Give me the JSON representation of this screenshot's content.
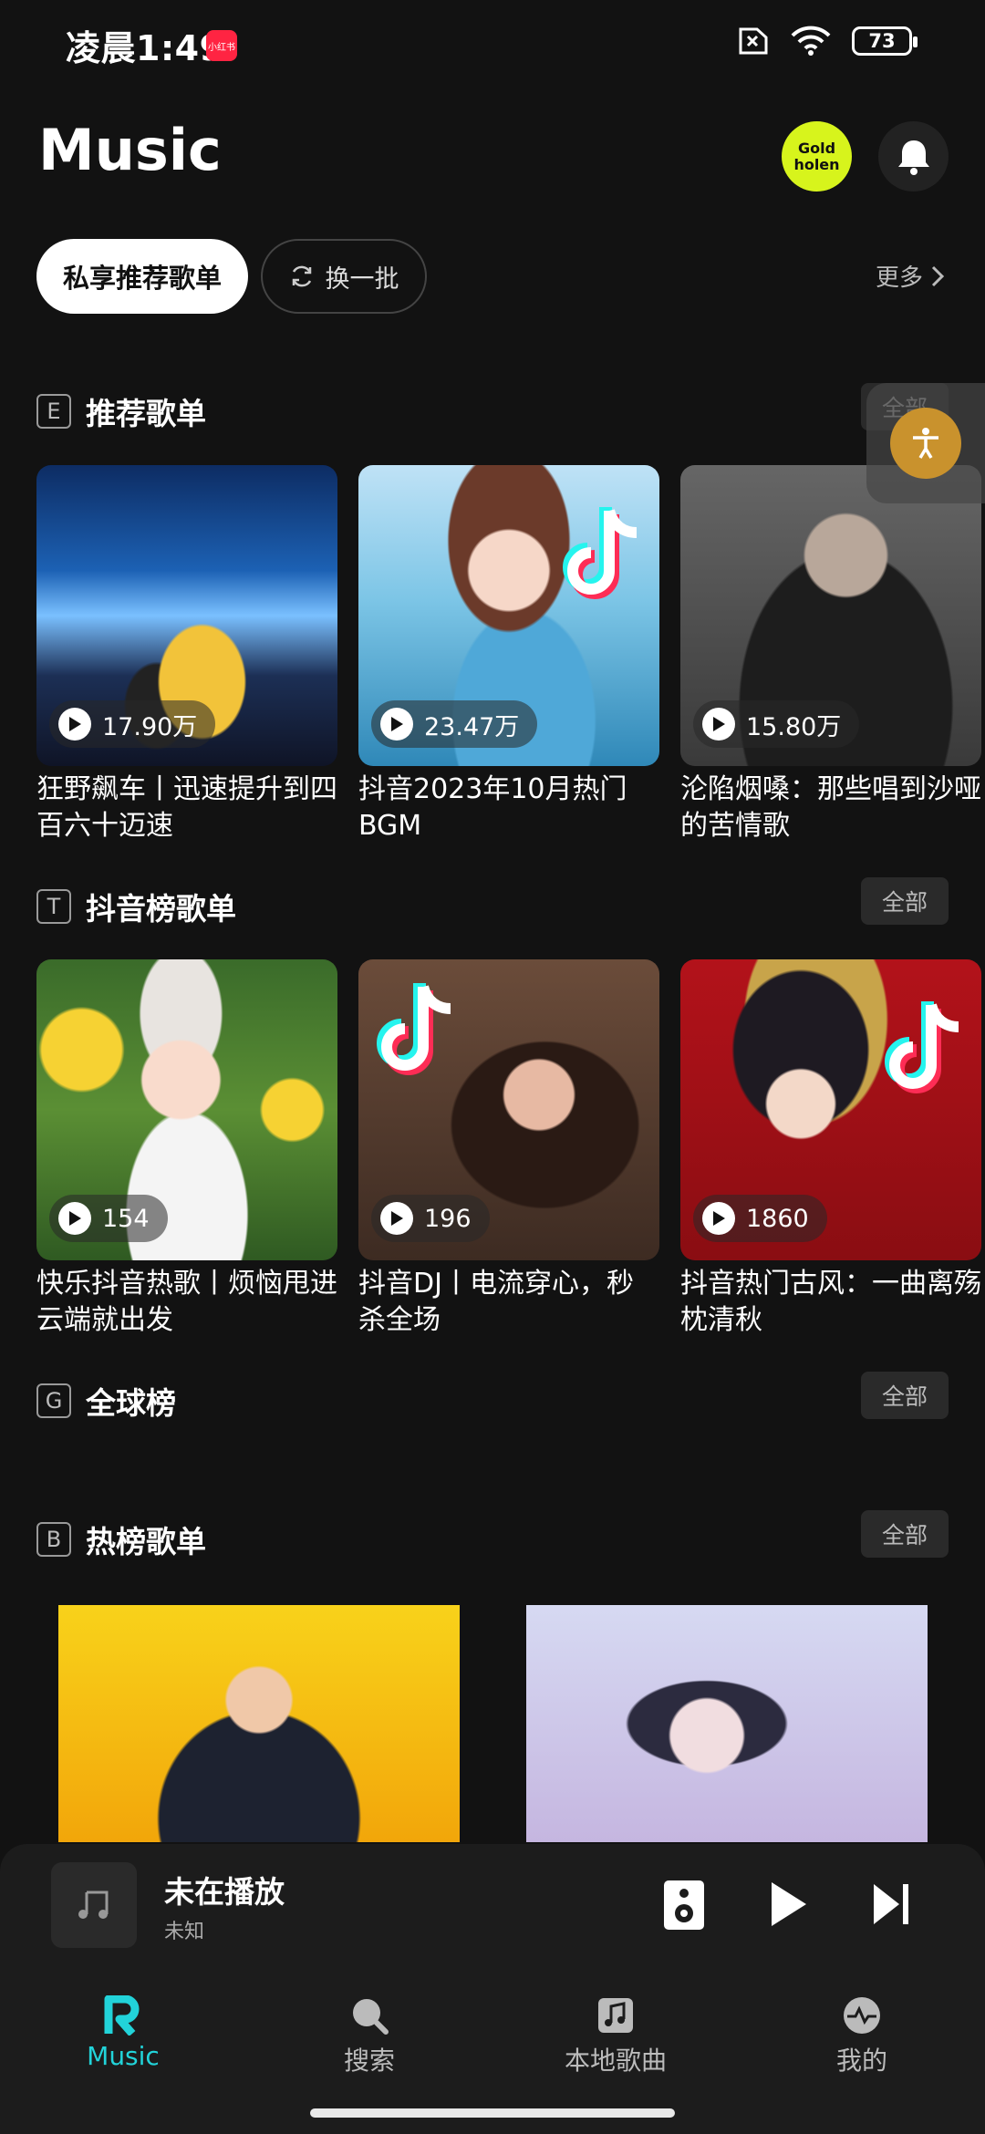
{
  "status": {
    "time": "凌晨1:49",
    "badge": "小红书",
    "battery": "73"
  },
  "header": {
    "title": "Music",
    "avatar_text": "Gold holen"
  },
  "chips": {
    "primary": "私享推荐歌单",
    "secondary": "换一批",
    "more": "更多"
  },
  "sections": [
    {
      "letter": "E",
      "title": "推荐歌单",
      "all": "全部",
      "cards": [
        {
          "count": "17.90万",
          "title": "狂野飙车丨迅速提升到四百六十迈速"
        },
        {
          "count": "23.47万",
          "title": "抖音2023年10月热门BGM"
        },
        {
          "count": "15.80万",
          "title": "沦陷烟嗓：那些唱到沙哑的苦情歌"
        }
      ]
    },
    {
      "letter": "T",
      "title": "抖音榜歌单",
      "all": "全部",
      "cards": [
        {
          "count": "154",
          "title": "快乐抖音热歌丨烦恼甩进云端就出发"
        },
        {
          "count": "196",
          "title": "抖音DJ丨电流穿心，秒杀全场"
        },
        {
          "count": "1860",
          "title": "抖音热门古风：一曲离殇枕清秋"
        }
      ]
    },
    {
      "letter": "G",
      "title": "全球榜",
      "all": "全部"
    },
    {
      "letter": "B",
      "title": "热榜歌单",
      "all": "全部"
    }
  ],
  "player": {
    "title": "未在播放",
    "subtitle": "未知"
  },
  "nav": [
    {
      "label": "Music",
      "icon": "music-r-logo-icon"
    },
    {
      "label": "搜索",
      "icon": "search-icon"
    },
    {
      "label": "本地歌曲",
      "icon": "local-music-icon"
    },
    {
      "label": "我的",
      "icon": "profile-pulse-icon"
    }
  ],
  "colors": {
    "accent": "#22d3d9",
    "background": "#121212",
    "avatar": "#d7f41c"
  }
}
